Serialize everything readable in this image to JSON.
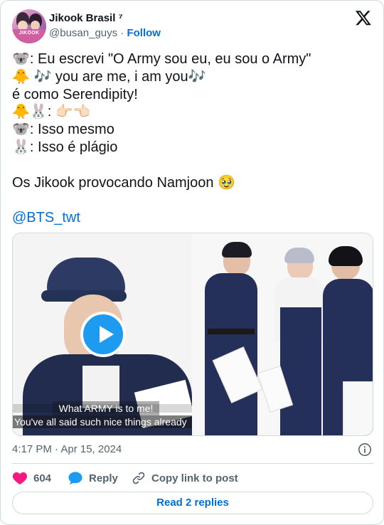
{
  "author": {
    "name": "Jikook Brasil ⁷",
    "handle": "@busan_guys",
    "separator": "·",
    "follow_label": "Follow",
    "avatar_text": "JIKOOK"
  },
  "tweet": {
    "lines": [
      "🐨: Eu escrevi \"O Army sou eu, eu sou o Army\"",
      "🐥 🎶  you are me, i am you🎶",
      "é como Serendipity!",
      "🐥🐰: 👉🏻👈🏻",
      "🐨: Isso mesmo",
      "🐰: Isso é plágio",
      "",
      "Os Jikook provocando Namjoon 🥹",
      ""
    ],
    "mention": "@BTS_twt"
  },
  "media": {
    "caption_top": "What ARMY is to me!",
    "caption_bottom": "You've all said such nice things already"
  },
  "timestamp": "4:17 PM · Apr 15, 2024",
  "actions": {
    "like_count": "604",
    "reply_label": "Reply",
    "copy_label": "Copy link to post"
  },
  "read_replies_label": "Read 2 replies",
  "colors": {
    "link": "#006fd6",
    "like": "#f91880",
    "reply": "#1d9bf0",
    "play": "#1d9bf0"
  }
}
